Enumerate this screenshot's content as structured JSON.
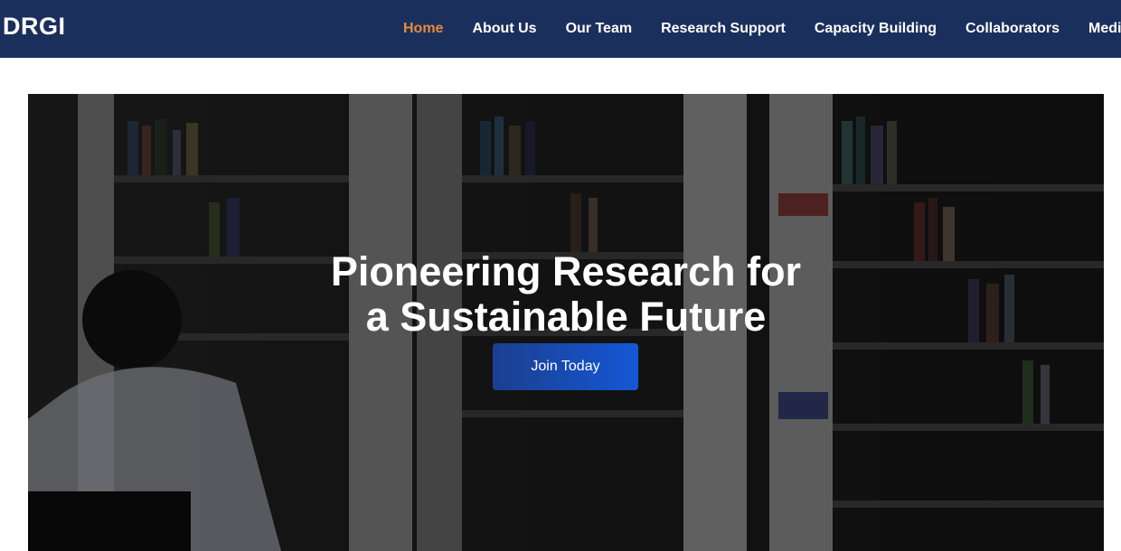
{
  "header": {
    "brand": "DRGI",
    "nav": [
      {
        "label": "Home",
        "active": true
      },
      {
        "label": "About Us"
      },
      {
        "label": "Our Team"
      },
      {
        "label": "Research Support"
      },
      {
        "label": "Capacity Building"
      },
      {
        "label": "Collaborators"
      },
      {
        "label": "Medi"
      }
    ]
  },
  "hero": {
    "title_line1": "Pioneering Research for",
    "title_line2": "a Sustainable Future",
    "cta_label": "Join Today"
  },
  "colors": {
    "navbar_bg": "#1b2f5c",
    "nav_active": "#e58a3c",
    "cta_start": "#1b3f8f",
    "cta_end": "#1557d6"
  }
}
